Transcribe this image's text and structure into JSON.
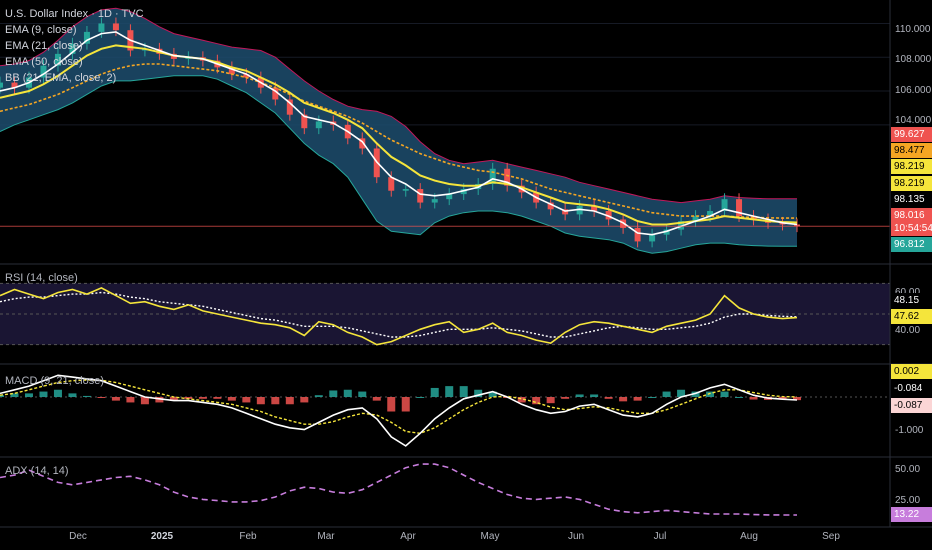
{
  "header": {
    "symbol_title": "U.S. Dollar Index · 1D · TVC",
    "indicators": [
      "EMA (9, close)",
      "EMA (21, close)",
      "EMA (50, close)",
      "BB (21, EMA, close, 2)"
    ]
  },
  "panes": {
    "rsi_label": "RSI (14, close)",
    "macd_label": "MACD (9, 21, close)",
    "adx_label": "ADX (14, 14)"
  },
  "colors": {
    "background": "#000000",
    "bb_fill": "#1d4e6e",
    "bb_border": "#c2185b",
    "ema9": "#ffffff",
    "ema21": "#f5e53b",
    "ema50": "#f5a623",
    "candle_up": "#26a69a",
    "candle_down": "#ef5350",
    "rsi": "#f5e53b",
    "adx": "#c77ddc"
  },
  "price_axis": {
    "ticks": [
      "110.000",
      "108.000",
      "106.000",
      "104.000"
    ],
    "badges": [
      {
        "value": "99.627",
        "color": "#ef5350",
        "text_color": "#ffffff"
      },
      {
        "value": "98.477",
        "color": "#f5a623",
        "text_color": "#000000"
      },
      {
        "value": "98.219",
        "color": "#f5e53b",
        "text_color": "#000000"
      },
      {
        "value": "98.219",
        "color": "#f5e53b",
        "text_color": "#000000"
      },
      {
        "value": "98.135",
        "color": "#000000",
        "text_color": "#ffffff"
      },
      {
        "value": "98.016",
        "color": "#ef5350",
        "text_color": "#ffffff"
      },
      {
        "value": "10:54:54",
        "color": "#ef5350",
        "text_color": "#ffffff"
      },
      {
        "value": "96.812",
        "color": "#26a69a",
        "text_color": "#ffffff"
      }
    ]
  },
  "rsi_axis": {
    "ticks": [
      "60.00",
      "40.00"
    ],
    "badges": [
      {
        "value": "48.15",
        "color": "#000000",
        "text_color": "#ffffff"
      },
      {
        "value": "47.62",
        "color": "#f5e53b",
        "text_color": "#000000"
      }
    ]
  },
  "macd_axis": {
    "ticks": [
      "-1.000"
    ],
    "badges": [
      {
        "value": "0.002",
        "color": "#f5e53b",
        "text_color": "#000000"
      },
      {
        "value": "-0.084",
        "color": "#000000",
        "text_color": "#ffffff"
      },
      {
        "value": "-0.087",
        "color": "#fbd5d5",
        "text_color": "#000000"
      }
    ]
  },
  "adx_axis": {
    "ticks": [
      "50.00",
      "25.00"
    ],
    "badges": [
      {
        "value": "13.22",
        "color": "#c77ddc",
        "text_color": "#ffffff"
      }
    ]
  },
  "time_axis": {
    "labels": [
      "Dec",
      "2025",
      "Feb",
      "Mar",
      "Apr",
      "May",
      "Jun",
      "Jul",
      "Aug",
      "Sep"
    ]
  },
  "chart_data": {
    "type": "line",
    "title": "U.S. Dollar Index · 1D · TVC",
    "x_months": [
      "Dec",
      "2025",
      "Feb",
      "Mar",
      "Apr",
      "May",
      "Jun",
      "Jul",
      "Aug",
      "Sep"
    ],
    "price": {
      "ylim": [
        96.0,
        110.5
      ],
      "close": [
        106.5,
        106.2,
        106.8,
        107.5,
        108.2,
        108.8,
        109.5,
        110.0,
        109.6,
        108.4,
        108.5,
        108.2,
        107.9,
        108.0,
        107.8,
        107.4,
        107.0,
        106.8,
        106.2,
        105.5,
        104.6,
        103.8,
        104.2,
        104.0,
        103.2,
        102.6,
        100.9,
        100.1,
        100.2,
        99.4,
        99.6,
        99.9,
        100.2,
        100.5,
        101.4,
        100.4,
        100.0,
        99.4,
        99.0,
        98.7,
        99.2,
        98.9,
        98.4,
        97.9,
        97.1,
        97.5,
        97.8,
        98.3,
        98.6,
        98.9,
        99.6,
        98.6,
        98.4,
        98.2,
        98.1,
        98.0
      ],
      "ema9": [
        106.0,
        106.2,
        106.5,
        107.0,
        107.6,
        108.3,
        109.0,
        109.4,
        109.5,
        109.0,
        108.7,
        108.4,
        108.1,
        108.0,
        107.9,
        107.6,
        107.3,
        107.0,
        106.5,
        106.0,
        105.3,
        104.5,
        104.3,
        104.1,
        103.6,
        103.0,
        101.8,
        100.9,
        100.5,
        99.9,
        99.8,
        99.9,
        100.1,
        100.3,
        100.8,
        100.6,
        100.2,
        99.7,
        99.3,
        98.9,
        99.0,
        98.9,
        98.6,
        98.2,
        97.6,
        97.5,
        97.7,
        98.0,
        98.3,
        98.6,
        99.0,
        98.8,
        98.6,
        98.4,
        98.2,
        98.1
      ],
      "ema21": [
        105.6,
        105.8,
        106.0,
        106.4,
        106.9,
        107.5,
        108.1,
        108.5,
        108.7,
        108.6,
        108.5,
        108.3,
        108.1,
        108.0,
        107.9,
        107.7,
        107.4,
        107.2,
        106.8,
        106.4,
        105.9,
        105.3,
        105.0,
        104.7,
        104.3,
        103.8,
        102.9,
        102.1,
        101.6,
        101.0,
        100.7,
        100.5,
        100.4,
        100.4,
        100.6,
        100.5,
        100.3,
        100.0,
        99.7,
        99.4,
        99.3,
        99.2,
        99.0,
        98.7,
        98.3,
        98.1,
        98.1,
        98.2,
        98.3,
        98.4,
        98.6,
        98.5,
        98.4,
        98.3,
        98.25,
        98.22
      ],
      "ema50": [
        104.8,
        105.0,
        105.2,
        105.5,
        105.8,
        106.2,
        106.6,
        107.0,
        107.3,
        107.5,
        107.6,
        107.6,
        107.5,
        107.4,
        107.3,
        107.2,
        107.0,
        106.8,
        106.5,
        106.2,
        105.8,
        105.4,
        105.1,
        104.8,
        104.5,
        104.1,
        103.6,
        103.1,
        102.7,
        102.3,
        102.0,
        101.7,
        101.5,
        101.3,
        101.2,
        101.0,
        100.8,
        100.5,
        100.2,
        100.0,
        99.8,
        99.6,
        99.4,
        99.2,
        99.0,
        98.8,
        98.7,
        98.6,
        98.6,
        98.6,
        98.6,
        98.55,
        98.52,
        98.5,
        98.48,
        98.48
      ],
      "bb_upper": [
        107.5,
        107.6,
        107.8,
        108.3,
        109.0,
        109.8,
        110.4,
        110.8,
        110.9,
        110.7,
        110.3,
        109.8,
        109.4,
        109.2,
        109.0,
        108.8,
        108.6,
        108.5,
        108.4,
        108.0,
        107.3,
        106.6,
        106.0,
        105.5,
        105.1,
        104.9,
        104.8,
        104.5,
        103.9,
        103.0,
        102.3,
        101.9,
        101.7,
        101.8,
        101.9,
        101.7,
        101.5,
        101.3,
        101.1,
        100.9,
        100.6,
        100.4,
        100.2,
        100.0,
        99.8,
        99.6,
        99.5,
        99.4,
        99.5,
        99.6,
        99.8,
        99.7,
        99.65,
        99.62,
        99.62,
        99.627
      ],
      "bb_lower": [
        103.6,
        104.0,
        104.3,
        104.6,
        104.9,
        105.3,
        105.8,
        106.3,
        106.6,
        106.6,
        106.7,
        106.8,
        106.9,
        106.9,
        106.9,
        106.7,
        106.3,
        105.9,
        105.3,
        104.7,
        103.8,
        102.9,
        102.2,
        101.7,
        100.9,
        99.6,
        98.3,
        97.7,
        97.6,
        97.5,
        98.2,
        98.6,
        98.8,
        98.9,
        98.9,
        98.8,
        98.6,
        98.3,
        98.0,
        97.6,
        97.4,
        97.3,
        97.2,
        97.0,
        96.6,
        96.4,
        96.5,
        96.7,
        96.9,
        97.0,
        97.0,
        96.9,
        96.85,
        96.82,
        96.81,
        96.812
      ]
    },
    "rsi": {
      "ylim": [
        20,
        80
      ],
      "values": [
        62,
        66,
        63,
        60,
        64,
        66,
        63,
        67,
        62,
        57,
        58,
        55,
        53,
        56,
        52,
        50,
        48,
        46,
        44,
        43,
        41,
        36,
        45,
        43,
        38,
        35,
        30,
        32,
        36,
        40,
        43,
        45,
        38,
        40,
        44,
        38,
        36,
        33,
        31,
        38,
        43,
        45,
        44,
        42,
        40,
        38,
        42,
        44,
        46,
        50,
        62,
        54,
        50,
        48,
        47,
        47.62
      ],
      "signal": [
        58,
        60,
        61,
        61,
        62,
        63,
        63,
        64,
        63,
        61,
        60,
        58,
        57,
        56,
        55,
        53,
        51,
        49,
        47,
        46,
        44,
        42,
        42,
        42,
        41,
        39,
        37,
        35,
        35,
        36,
        38,
        40,
        40,
        40,
        41,
        40,
        39,
        37,
        35,
        35,
        37,
        39,
        41,
        42,
        41,
        40,
        40,
        41,
        42,
        44,
        48,
        50,
        50,
        49,
        48.5,
        48.15
      ]
    },
    "macd": {
      "ylim": [
        -1.6,
        0.8
      ],
      "macd": [
        0.1,
        0.2,
        0.3,
        0.45,
        0.6,
        0.55,
        0.5,
        0.45,
        0.3,
        0.15,
        0.0,
        -0.05,
        -0.1,
        -0.1,
        -0.15,
        -0.2,
        -0.3,
        -0.45,
        -0.6,
        -0.75,
        -0.85,
        -0.9,
        -0.7,
        -0.5,
        -0.35,
        -0.3,
        -0.6,
        -1.1,
        -1.35,
        -1.0,
        -0.6,
        -0.3,
        -0.05,
        0.05,
        0.15,
        0.0,
        -0.2,
        -0.35,
        -0.45,
        -0.4,
        -0.25,
        -0.2,
        -0.35,
        -0.5,
        -0.55,
        -0.45,
        -0.2,
        0.0,
        0.1,
        0.25,
        0.35,
        0.2,
        0.05,
        -0.03,
        -0.06,
        -0.084
      ],
      "signal": [
        0.05,
        0.1,
        0.2,
        0.3,
        0.4,
        0.45,
        0.47,
        0.46,
        0.4,
        0.3,
        0.2,
        0.1,
        0.0,
        -0.05,
        -0.1,
        -0.15,
        -0.2,
        -0.3,
        -0.4,
        -0.55,
        -0.65,
        -0.75,
        -0.75,
        -0.68,
        -0.55,
        -0.45,
        -0.5,
        -0.7,
        -0.95,
        -1.0,
        -0.85,
        -0.6,
        -0.35,
        -0.15,
        0.0,
        0.02,
        -0.05,
        -0.15,
        -0.28,
        -0.35,
        -0.32,
        -0.27,
        -0.3,
        -0.38,
        -0.45,
        -0.45,
        -0.35,
        -0.2,
        -0.05,
        0.1,
        0.2,
        0.2,
        0.12,
        0.05,
        0.01,
        0.002
      ],
      "histogram": [
        0.05,
        0.1,
        0.1,
        0.15,
        0.2,
        0.1,
        0.03,
        -0.01,
        -0.1,
        -0.15,
        -0.2,
        -0.15,
        -0.1,
        -0.05,
        -0.05,
        -0.05,
        -0.1,
        -0.15,
        -0.2,
        -0.2,
        -0.2,
        -0.15,
        0.05,
        0.18,
        0.2,
        0.15,
        -0.1,
        -0.4,
        -0.4,
        0.0,
        0.25,
        0.3,
        0.3,
        0.2,
        0.15,
        -0.02,
        -0.15,
        -0.2,
        -0.17,
        -0.05,
        0.07,
        0.07,
        -0.05,
        -0.12,
        -0.1,
        0.0,
        0.15,
        0.2,
        0.15,
        0.15,
        0.15,
        0.0,
        -0.07,
        -0.08,
        -0.07,
        -0.087
      ]
    },
    "adx": {
      "ylim": [
        5,
        60
      ],
      "values": [
        44,
        46,
        50,
        45,
        40,
        38,
        40,
        42,
        44,
        45,
        42,
        38,
        32,
        28,
        26,
        25,
        24,
        24,
        25,
        28,
        33,
        36,
        35,
        32,
        31,
        34,
        40,
        46,
        52,
        55,
        55,
        52,
        46,
        40,
        35,
        30,
        27,
        26,
        27,
        28,
        26,
        22,
        18,
        16,
        15,
        16,
        17,
        16,
        15,
        14,
        14,
        14,
        13.5,
        13.3,
        13.2,
        13.22
      ]
    }
  }
}
